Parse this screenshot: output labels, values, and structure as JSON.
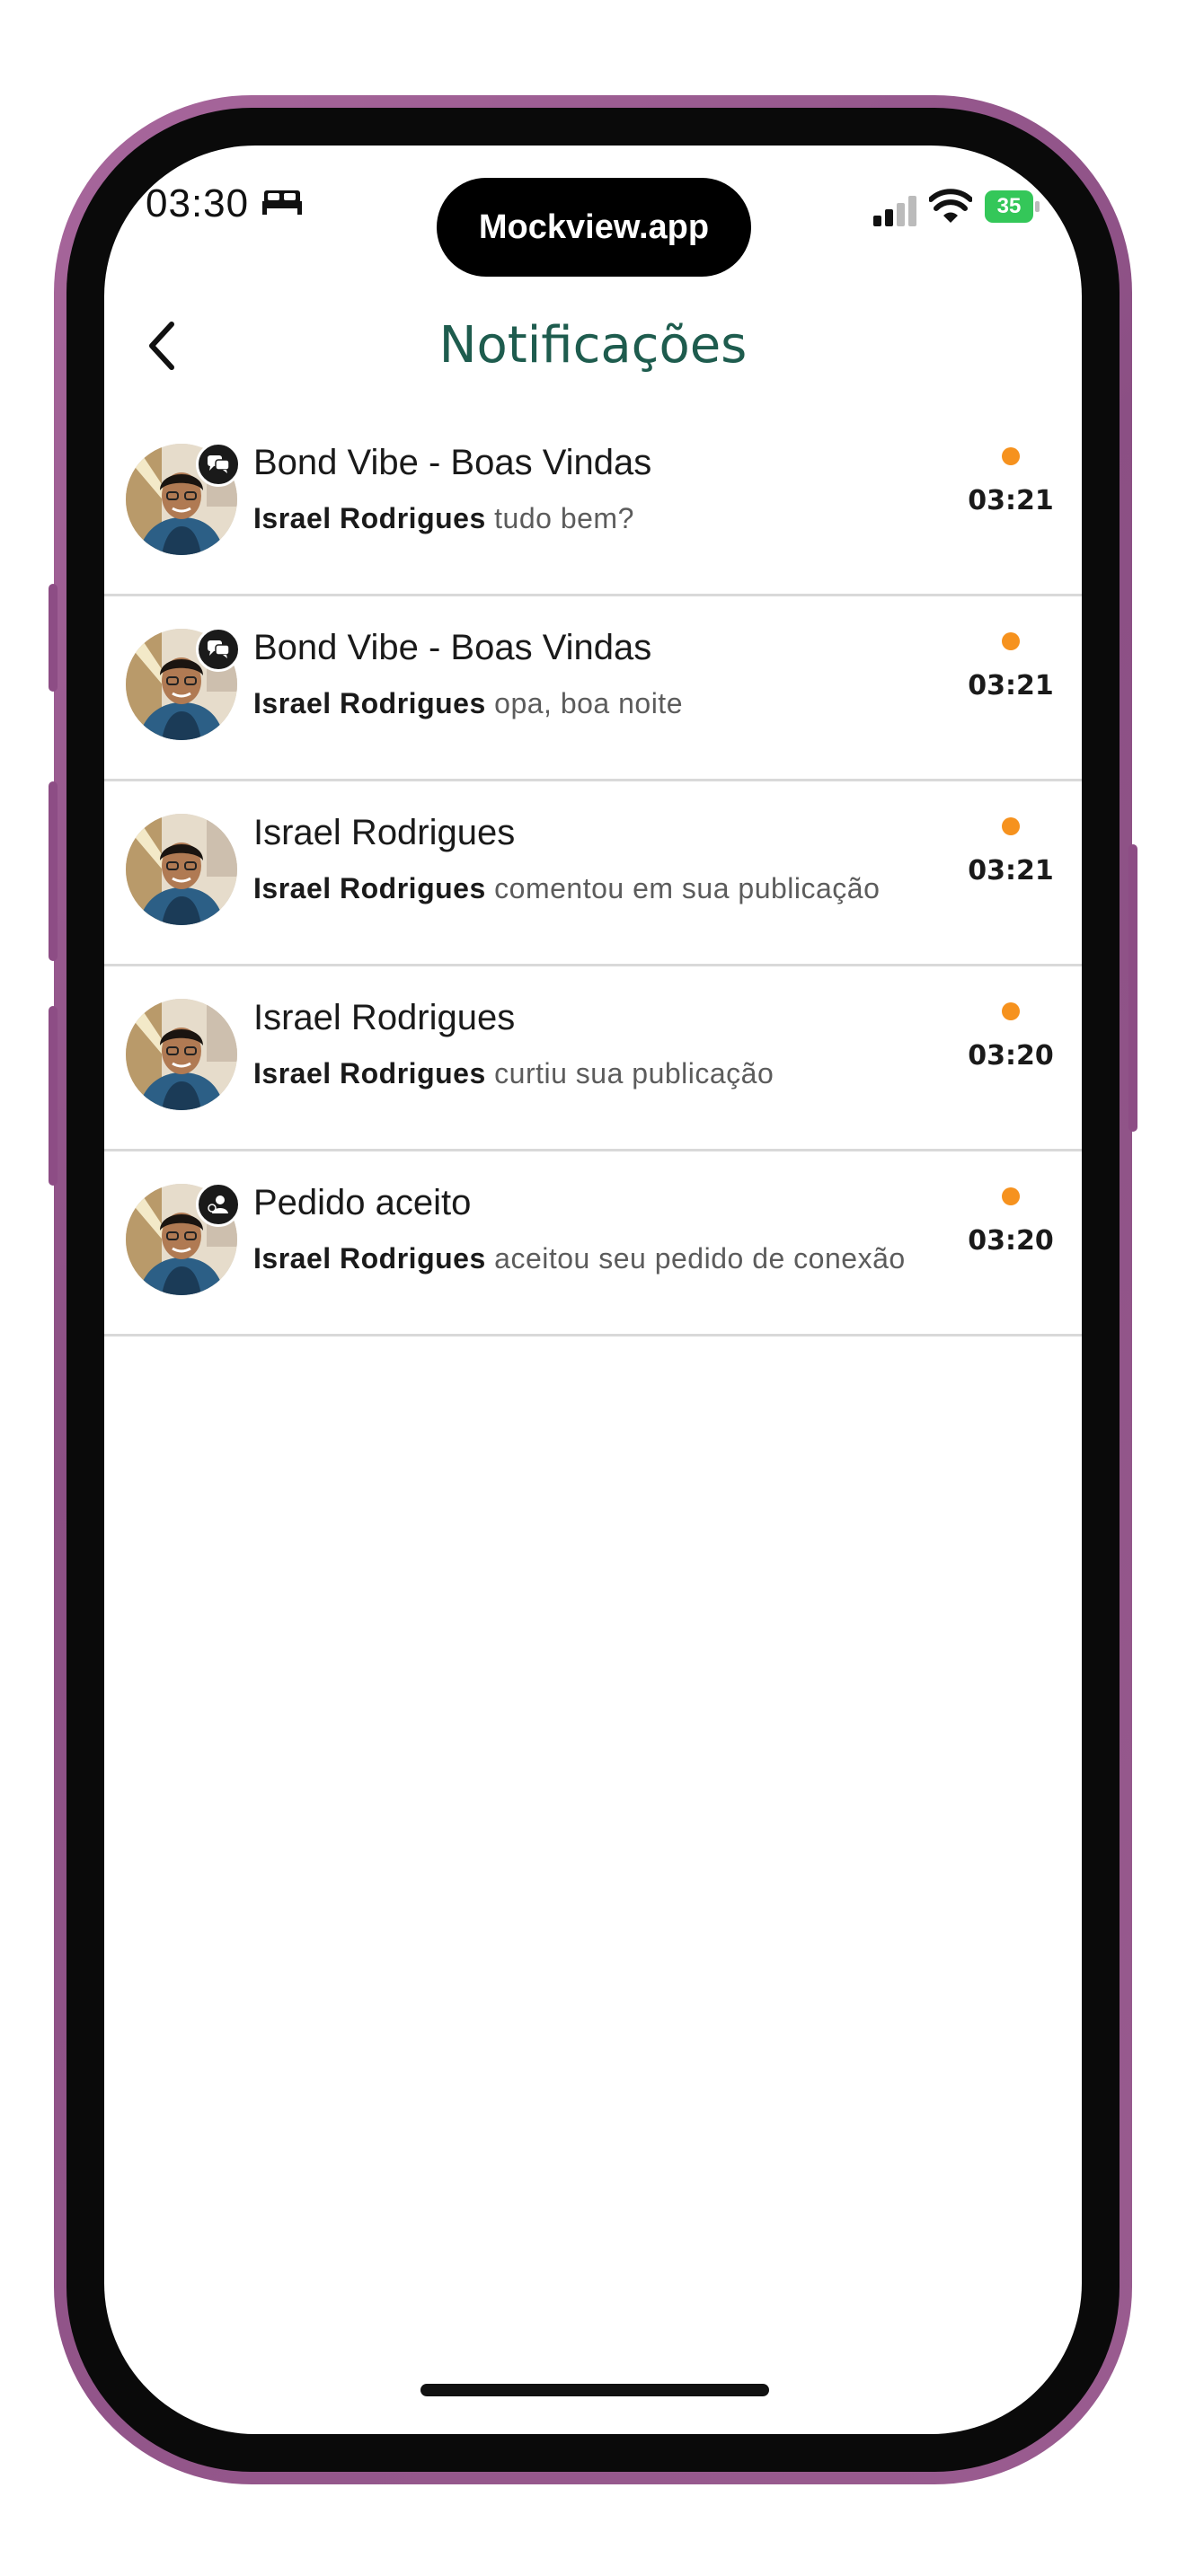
{
  "status_bar": {
    "time": "03:30",
    "focus_icon": "bed-icon",
    "battery_level": "35"
  },
  "island": {
    "label": "Mockview.app"
  },
  "header": {
    "title": "Notificações",
    "back_icon": "chevron-left-icon"
  },
  "colors": {
    "title": "#1e5c4e",
    "unread_dot": "#f6921e",
    "frame": "#9a5c90"
  },
  "notifications": [
    {
      "title": "Bond Vibe - Boas Vindas",
      "actor": "Israel Rodrigues",
      "message": "tudo bem?",
      "time": "03:21",
      "unread": true,
      "badge_icon": "chat-icon"
    },
    {
      "title": "Bond Vibe - Boas Vindas",
      "actor": "Israel Rodrigues",
      "message": "opa, boa noite",
      "time": "03:21",
      "unread": true,
      "badge_icon": "chat-icon"
    },
    {
      "title": "Israel Rodrigues",
      "actor": "Israel Rodrigues",
      "message": "comentou em sua publicação",
      "time": "03:21",
      "unread": true,
      "badge_icon": null
    },
    {
      "title": "Israel Rodrigues",
      "actor": "Israel Rodrigues",
      "message": "curtiu sua publicação",
      "time": "03:20",
      "unread": true,
      "badge_icon": null
    },
    {
      "title": "Pedido aceito",
      "actor": "Israel Rodrigues",
      "message": "aceitou seu pedido de conexão",
      "time": "03:20",
      "unread": true,
      "badge_icon": "user-check-icon"
    }
  ]
}
